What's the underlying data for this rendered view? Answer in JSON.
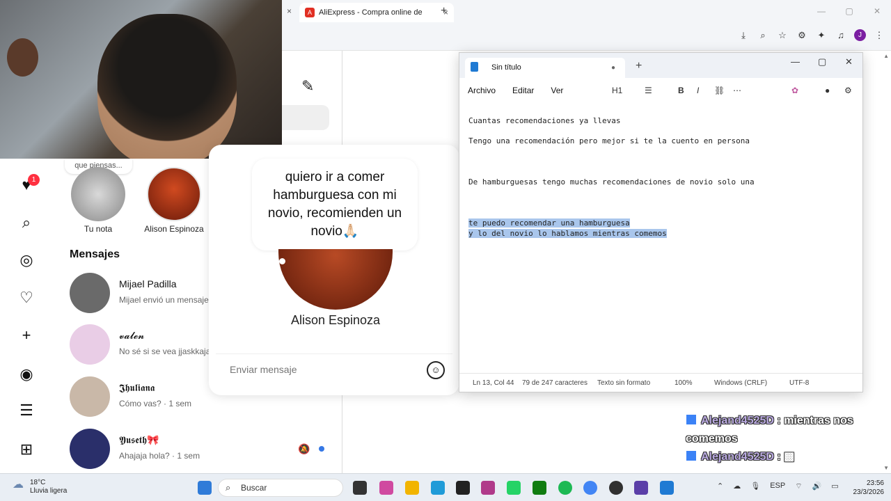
{
  "browser": {
    "tab_title": "AliExpress - Compra online de",
    "tab_close": "×",
    "prev_tab_close": "×",
    "new_tab": "+",
    "window_controls": [
      "—",
      "▢",
      "✕"
    ],
    "toolbar_icons": [
      "download-icon",
      "zoom-icon",
      "star-icon",
      "extension-icon",
      "puzzle-icon",
      "media-icon"
    ],
    "profile_initial": "J"
  },
  "instagram": {
    "note_bubble": "que piensas...",
    "notification_count": "1",
    "stories": [
      {
        "label": "Tu nota"
      },
      {
        "label": "Alison Espinoza"
      }
    ],
    "messages_heading": "Mensajes",
    "messages": [
      {
        "name": "Mijael Padilla",
        "preview": "Mijael envió un mensaje",
        "avatar_color": "#6a6a6a"
      },
      {
        "name": "𝓿𝓪𝓵𝓮𝓷",
        "preview": "No sé si se vea jjaskkaja",
        "avatar_color": "#e9cde6"
      },
      {
        "name": "𝕵𝖍𝖚𝖑𝖎𝖆𝖓𝖆",
        "preview": "Cómo vas? · 1 sem",
        "avatar_color": "#c9b8a8"
      },
      {
        "name": "𝖄𝖚𝖘𝖊𝖙𝖍🎀",
        "preview": "Ahajaja hola? · 1 sem",
        "avatar_color": "#2a2f6a"
      }
    ],
    "note_popup": {
      "note_text": "quiero ir a comer hamburguesa con mi novio, recomienden un novio🙏🏻",
      "user_name": "Alison Espinoza",
      "send_placeholder": "Enviar mensaje"
    }
  },
  "notepad": {
    "tab_title": "Sin título",
    "new_tab": "+",
    "menu": [
      "Archivo",
      "Editar",
      "Ver"
    ],
    "heading_select": "H1",
    "lines": [
      {
        "text": "Cuantas recomendaciones ya llevas",
        "selected": false
      },
      {
        "text": "Tengo una recomendación pero mejor si te la cuento en persona",
        "selected": false
      },
      {
        "text": "De hamburguesas tengo muchas recomendaciones de novio solo una",
        "selected": false
      },
      {
        "text": "te puedo recomendar una hamburguesa",
        "selected": true
      },
      {
        "text": "y lo del novio lo hablamos mientras comemos",
        "selected": true
      }
    ],
    "status": {
      "position": "Ln 13, Col 44",
      "chars": "79 de 247 caracteres",
      "format": "Texto sin formato",
      "zoom": "100%",
      "line_ending": "Windows (CRLF)",
      "encoding": "UTF-8"
    }
  },
  "chat": [
    {
      "user": "Alejand4525D",
      "message": "mientras nos comemos"
    },
    {
      "user": "Alejand4525D",
      "message": ""
    }
  ],
  "taskbar": {
    "temperature": "18°C",
    "weather": "Lluvia ligera",
    "search_label": "Buscar",
    "language": "ESP",
    "time": "23:56",
    "date": "23/3/2026"
  }
}
